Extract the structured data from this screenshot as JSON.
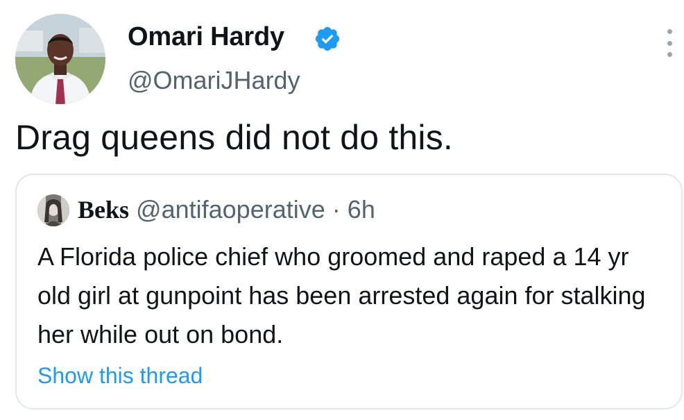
{
  "tweet": {
    "author": {
      "display_name": "Omari Hardy",
      "handle": "@OmariJHardy",
      "verified": true,
      "verified_icon": "verified-badge-icon"
    },
    "text": "Drag queens did not do this.",
    "more_icon": "more-vertical-icon"
  },
  "quoted_tweet": {
    "author": {
      "display_name": "Beks",
      "handle": "@antifaoperative"
    },
    "separator": "·",
    "time": "6h",
    "text": "A Florida police chief who groomed and raped a 14 yr old girl at gunpoint has been arrested again for stalking her while out on bond.",
    "show_thread_label": "Show this thread"
  },
  "colors": {
    "verified_blue": "#1d9bf0",
    "link_blue": "#1d9bf0",
    "secondary_text": "#536471",
    "card_border": "#e3e7ea"
  }
}
